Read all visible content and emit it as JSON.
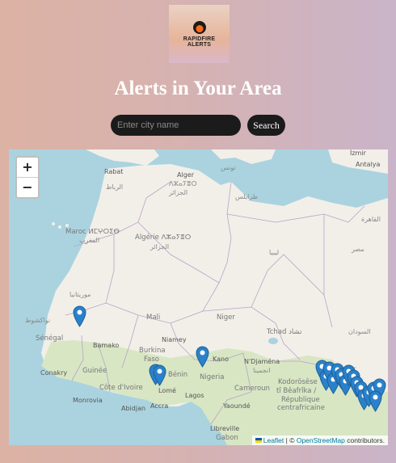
{
  "logo": {
    "line1": "RAPIDFIRE",
    "line2": "ALERTS"
  },
  "page_title": "Alerts in Your Area",
  "search": {
    "placeholder": "Enter city name",
    "button_label": "Search"
  },
  "map": {
    "zoom_in": "+",
    "zoom_out": "−",
    "attribution": {
      "leaflet": "Leaflet",
      "separator": " | © ",
      "osm": "OpenStreetMap",
      "suffix": " contributors."
    },
    "labels": {
      "rabat": "Rabat",
      "rabat_ar": "الرباط",
      "alger": "Alger",
      "alger_tz": "ⴷⵣⴰⵢⴻⵔ",
      "alger_ar": "الجزائر",
      "tunis": "تونس",
      "tarabulus": "طرابلس",
      "cairo": "القاهرة",
      "izmir": "İzmir",
      "antalya": "Antalya",
      "maroc": "Maroc ⵍⵎⵖⵔⵉⴱ",
      "maroc_ar": "المغرب",
      "algerie": "Algérie ⴷⵣⴰⵢⴻⵔ",
      "algerie_ar": "الجزائر",
      "libya_ar": "ليبيا",
      "egypt_ar": "مصر",
      "mauritania_ar": "موريتانيا",
      "nouakchott": "نواكشوط",
      "mali": "Mali",
      "niger": "Niger",
      "tchad": "Tchad تشاد",
      "sudan_ar": "السودان",
      "senegal": "Sénégal",
      "bamako": "Bamako",
      "niamey": "Niamey",
      "burkina": "Burkina",
      "faso": "Faso",
      "kano": "Kano",
      "ndjamena": "N'Djaména",
      "ndjamena_ar": "انجمينا",
      "conakry": "Conakry",
      "guinee": "Guinée",
      "benin": "Bénin",
      "nigeria": "Nigeria",
      "cote_ivoire": "Côte d'Ivoire",
      "monrovia": "Monrovia",
      "abidjan": "Abidjan",
      "lome": "Lomé",
      "accra": "Accra",
      "lagos": "Lagos",
      "cameroun": "Cameroun",
      "yaounde": "Yaoundé",
      "kodorosese": "Kodorösêse",
      "beafrika": "tî Bêafrîka /",
      "republique": "République",
      "centrafricaine": "centrafricaine",
      "libreville": "Libreville",
      "gabon": "Gabon"
    }
  }
}
